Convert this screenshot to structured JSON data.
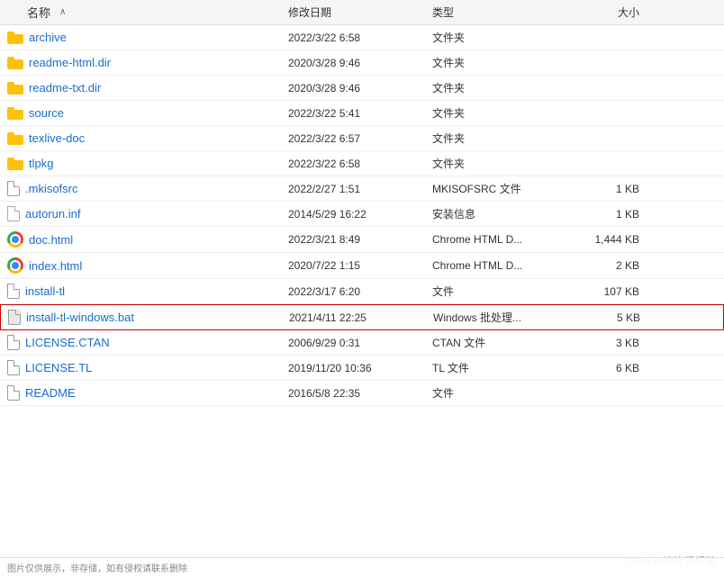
{
  "columns": {
    "name": "名称",
    "date": "修改日期",
    "type": "类型",
    "size": "大小"
  },
  "files": [
    {
      "name": "archive",
      "date": "2022/3/22 6:58",
      "type": "文件夹",
      "size": "",
      "icon": "folder",
      "selected": false
    },
    {
      "name": "readme-html.dir",
      "date": "2020/3/28 9:46",
      "type": "文件夹",
      "size": "",
      "icon": "folder",
      "selected": false
    },
    {
      "name": "readme-txt.dir",
      "date": "2020/3/28 9:46",
      "type": "文件夹",
      "size": "",
      "icon": "folder",
      "selected": false
    },
    {
      "name": "source",
      "date": "2022/3/22 5:41",
      "type": "文件夹",
      "size": "",
      "icon": "folder",
      "selected": false
    },
    {
      "name": "texlive-doc",
      "date": "2022/3/22 6:57",
      "type": "文件夹",
      "size": "",
      "icon": "folder",
      "selected": false
    },
    {
      "name": "tlpkg",
      "date": "2022/3/22 6:58",
      "type": "文件夹",
      "size": "",
      "icon": "folder",
      "selected": false
    },
    {
      "name": ".mkisofsrc",
      "date": "2022/2/27 1:51",
      "type": "MKISOFSRC 文件",
      "size": "1 KB",
      "icon": "file",
      "selected": false
    },
    {
      "name": "autorun.inf",
      "date": "2014/5/29 16:22",
      "type": "安装信息",
      "size": "1 KB",
      "icon": "inf",
      "selected": false
    },
    {
      "name": "doc.html",
      "date": "2022/3/21 8:49",
      "type": "Chrome HTML D...",
      "size": "1,444 KB",
      "icon": "chrome",
      "selected": false
    },
    {
      "name": "index.html",
      "date": "2020/7/22 1:15",
      "type": "Chrome HTML D...",
      "size": "2 KB",
      "icon": "chrome",
      "selected": false
    },
    {
      "name": "install-tl",
      "date": "2022/3/17 6:20",
      "type": "文件",
      "size": "107 KB",
      "icon": "file",
      "selected": false
    },
    {
      "name": "install-tl-windows.bat",
      "date": "2021/4/11 22:25",
      "type": "Windows 批处理...",
      "size": "5 KB",
      "icon": "bat",
      "selected": true
    },
    {
      "name": "LICENSE.CTAN",
      "date": "2006/9/29 0:31",
      "type": "CTAN 文件",
      "size": "3 KB",
      "icon": "file",
      "selected": false
    },
    {
      "name": "LICENSE.TL",
      "date": "2019/11/20 10:36",
      "type": "TL 文件",
      "size": "6 KB",
      "icon": "file",
      "selected": false
    },
    {
      "name": "README",
      "date": "2016/5/8 22:35",
      "type": "文件",
      "size": "",
      "icon": "file",
      "selected": false
    }
  ],
  "watermark": "CSDN @神兽 汤姆猫",
  "copyright": "图片仅供展示，非存储，如有侵权请联系删除"
}
